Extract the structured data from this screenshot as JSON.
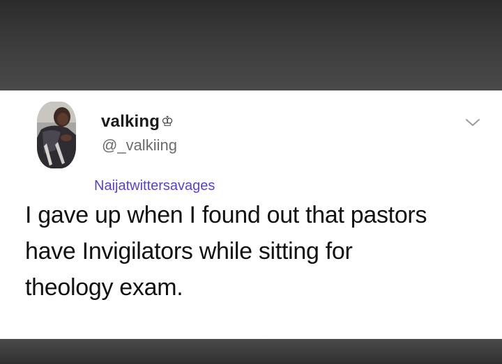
{
  "tweet": {
    "display_name": "valking",
    "name_emoji": "♔",
    "handle": "@_valkiing",
    "watermark": "Naijatwittersavages",
    "text_lines": [
      "I gave up when I found out that pastors",
      "have Invigilators while sitting for",
      "theology exam."
    ],
    "menu_icon": "chevron-down-icon",
    "avatar_icon": "user-photo"
  },
  "colors": {
    "card_background": "#ffffff",
    "outer_background": "#3a3a3a",
    "text": "#111111",
    "handle": "#6b6b6b",
    "watermark": "#5b3fd1"
  }
}
